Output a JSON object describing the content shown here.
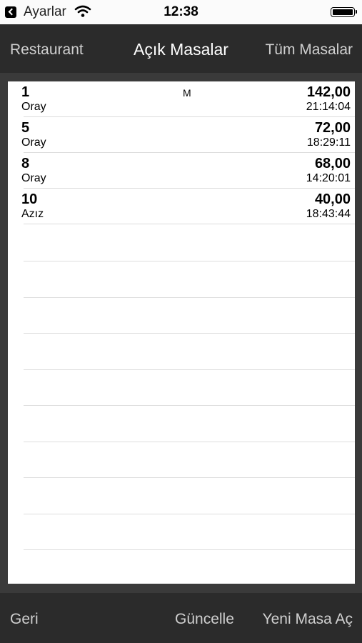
{
  "status_bar": {
    "back_app": "Ayarlar",
    "time": "12:38"
  },
  "nav": {
    "left": "Restaurant",
    "title": "Açık Masalar",
    "right": "Tüm Masalar"
  },
  "tables": [
    {
      "number": "1",
      "waiter": "Oray",
      "flag": "M",
      "amount": "142,00",
      "time": "21:14:04"
    },
    {
      "number": "5",
      "waiter": "Oray",
      "flag": "",
      "amount": "72,00",
      "time": "18:29:11"
    },
    {
      "number": "8",
      "waiter": "Oray",
      "flag": "",
      "amount": "68,00",
      "time": "14:20:01"
    },
    {
      "number": "10",
      "waiter": "Azız",
      "flag": "",
      "amount": "40,00",
      "time": "18:43:44"
    }
  ],
  "toolbar": {
    "back": "Geri",
    "refresh": "Güncelle",
    "new_table": "Yeni Masa Aç"
  }
}
